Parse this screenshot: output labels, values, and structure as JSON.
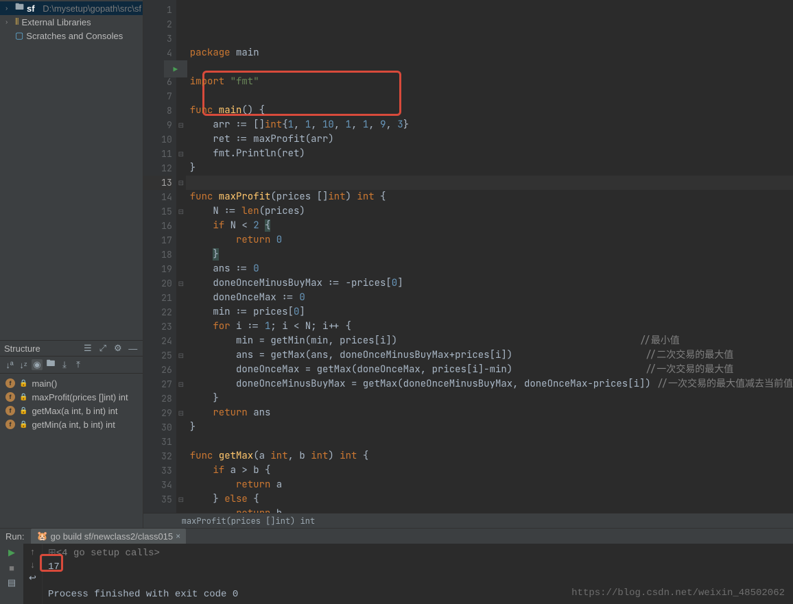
{
  "project": {
    "root_name": "sf",
    "root_path": "D:\\mysetup\\gopath\\src\\sf",
    "external_libs": "External Libraries",
    "scratches": "Scratches and Consoles"
  },
  "structure": {
    "title": "Structure",
    "items": [
      {
        "name": "main()"
      },
      {
        "name": "maxProfit(prices []int) int"
      },
      {
        "name": "getMax(a int, b int) int"
      },
      {
        "name": "getMin(a int, b int) int"
      }
    ]
  },
  "code": {
    "caret_line": 13,
    "lines": [
      {
        "n": 1,
        "html": "<span class='kw'>package</span> <span class='pkg'>main</span>"
      },
      {
        "n": 2,
        "html": ""
      },
      {
        "n": 3,
        "html": "<span class='kw'>import</span> <span class='str'>\"fmt\"</span>"
      },
      {
        "n": 4,
        "html": ""
      },
      {
        "n": 5,
        "html": "<span class='kw'>func</span> <span class='fn'>main</span>() {",
        "fold": "⊟",
        "run": true
      },
      {
        "n": 6,
        "html": "    arr := []<span class='intkw'>int</span>{<span class='num'>1</span>, <span class='num'>1</span>, <span class='num'>10</span>, <span class='num'>1</span>, <span class='num'>1</span>, <span class='num'>9</span>, <span class='num'>3</span>}"
      },
      {
        "n": 7,
        "html": "    ret := maxProfit(arr)"
      },
      {
        "n": 8,
        "html": "    fmt.Println(ret)"
      },
      {
        "n": 9,
        "html": "}",
        "fold": "⊟"
      },
      {
        "n": 10,
        "html": ""
      },
      {
        "n": 11,
        "html": "<span class='kw'>func</span> <span class='fn'>maxProfit</span>(prices []<span class='intkw'>int</span>) <span class='intkw'>int</span> {",
        "fold": "⊟"
      },
      {
        "n": 12,
        "html": "    N := <span class='builtin'>len</span>(prices)"
      },
      {
        "n": 13,
        "html": "    <span class='kw'>if</span> N &lt; <span class='num'>2</span> <span style='background:#3b514d'>{</span>",
        "fold": "⊟"
      },
      {
        "n": 14,
        "html": "        <span class='kw'>return</span> <span class='num'>0</span>"
      },
      {
        "n": 15,
        "html": "    <span style='background:#3b514d'>}</span>",
        "fold": "⊟"
      },
      {
        "n": 16,
        "html": "    ans := <span class='num'>0</span>"
      },
      {
        "n": 17,
        "html": "    doneOnceMinusBuyMax := -prices[<span class='num'>0</span>]"
      },
      {
        "n": 18,
        "html": "    doneOnceMax := <span class='num'>0</span>"
      },
      {
        "n": 19,
        "html": "    min := prices[<span class='num'>0</span>]"
      },
      {
        "n": 20,
        "html": "    <span class='kw'>for</span> i := <span class='num'>1</span>; i &lt; N; i++ {",
        "fold": "⊟"
      },
      {
        "n": 21,
        "html": "        min = getMin(min, prices[i])                                          <span class='comment'>//最小值</span>"
      },
      {
        "n": 22,
        "html": "        ans = getMax(ans, doneOnceMinusBuyMax+prices[i])                       <span class='comment'>//二次交易的最大值</span>"
      },
      {
        "n": 23,
        "html": "        doneOnceMax = getMax(doneOnceMax, prices[i]-min)                       <span class='comment'>//一次交易的最大值</span>"
      },
      {
        "n": 24,
        "html": "        doneOnceMinusBuyMax = getMax(doneOnceMinusBuyMax, doneOnceMax-prices[i]) <span class='comment'>//一次交易的最大值减去当前值</span>"
      },
      {
        "n": 25,
        "html": "    }",
        "fold": "⊟"
      },
      {
        "n": 26,
        "html": "    <span class='kw'>return</span> ans"
      },
      {
        "n": 27,
        "html": "}",
        "fold": "⊟"
      },
      {
        "n": 28,
        "html": ""
      },
      {
        "n": 29,
        "html": "<span class='kw'>func</span> <span class='fn'>getMax</span>(a <span class='intkw'>int</span>, b <span class='intkw'>int</span>) <span class='intkw'>int</span> {",
        "fold": "⊟"
      },
      {
        "n": 30,
        "html": "    <span class='kw'>if</span> a &gt; b {"
      },
      {
        "n": 31,
        "html": "        <span class='kw'>return</span> a"
      },
      {
        "n": 32,
        "html": "    } <span class='kw'>else</span> {"
      },
      {
        "n": 33,
        "html": "        <span class='kw'>return</span> b"
      },
      {
        "n": 34,
        "html": "    }"
      },
      {
        "n": 35,
        "html": "}",
        "fold": "⊟"
      }
    ],
    "breadcrumb": "maxProfit(prices []int) int"
  },
  "run": {
    "label": "Run:",
    "tab": "go build sf/newclass2/class015",
    "out1": "<4 go setup calls>",
    "out2": "17",
    "out3": "Process finished with exit code 0"
  },
  "watermark": "https://blog.csdn.net/weixin_48502062"
}
